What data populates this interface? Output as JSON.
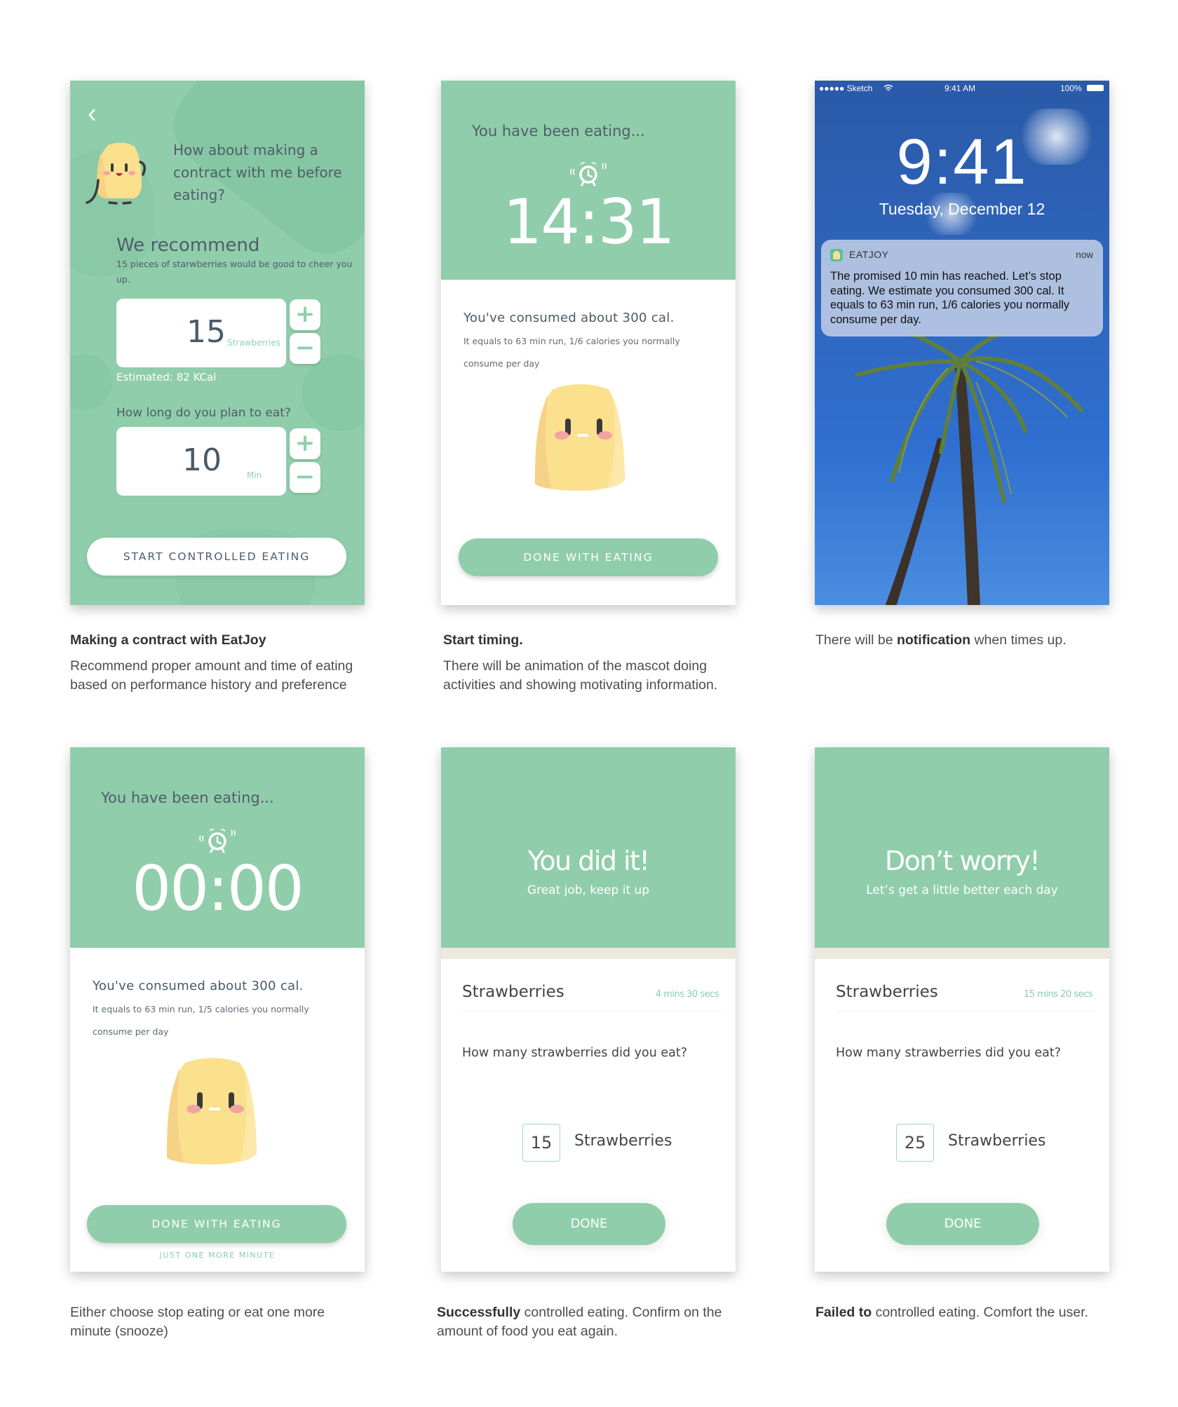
{
  "brand": {
    "accent": "#90cdab",
    "mascot_yellow": "#fbe08d",
    "text_dark": "#4f5d69"
  },
  "screens": {
    "contract": {
      "back_icon": "chevron-left-icon",
      "speech": "How about making a contract with me before eating?",
      "recommend_title": "We recommend",
      "recommend_sub": "15 pieces of starwberries would be good to cheer you up.",
      "amount_value": "15",
      "amount_unit": "Strawberries",
      "plus_label": "+",
      "minus_label": "−",
      "estimated": "Estimated: 82 KCal",
      "duration_question": "How long do you plan to eat?",
      "duration_value": "10",
      "duration_unit": "Min",
      "start_button": "START CONTROLLED EATING"
    },
    "timing": {
      "header": "You have been eating...",
      "timer": "14:31",
      "consumed": "You've consumed about 300 cal.",
      "equals": "It equals to 63 min run, 1/6 calories you normally consume per day",
      "done_button": "DONE WITH EATING"
    },
    "lockscreen": {
      "carrier": "●●●●● Sketch",
      "status_time": "9:41 AM",
      "battery": "100%",
      "time": "9:41",
      "date": "Tuesday, December 12",
      "notification": {
        "app": "EATJOY",
        "when": "now",
        "body": "The promised 10 min has reached. Let’s stop eating. We estimate you consumed 300 cal. It equals to 63 min run, 1/6 calories you normally consume per day."
      }
    },
    "timeup": {
      "header": "You have been eating...",
      "timer": "00:00",
      "consumed": "You've consumed about 300 cal.",
      "equals": "It equals to 63 min run, 1/5 calories you normally consume per day",
      "done_button": "DONE WITH EATING",
      "snooze_link": "JUST ONE MORE MINUTE"
    },
    "success": {
      "title": "You did it!",
      "subtitle": "Great job, keep it up",
      "food": "Strawberries",
      "duration": "4 mins 30 secs",
      "question": "How many strawberries did you eat?",
      "count": "15",
      "count_unit": "Strawberries",
      "done_button": "DONE"
    },
    "failure": {
      "title": "Don’t worry!",
      "subtitle": "Let’s get a little better each day",
      "food": "Strawberries",
      "duration": "15 mins 20 secs",
      "question": "How many strawberries did you eat?",
      "count": "25",
      "count_unit": "Strawberries",
      "done_button": "DONE"
    }
  },
  "captions": {
    "contract": {
      "title": "Making a contract with EatJoy",
      "body": "Recommend proper amount and time of eating based on performance history and preference"
    },
    "timing": {
      "title": "Start timing.",
      "body": "There will be animation of the mascot doing activities and showing motivating information."
    },
    "lockscreen": {
      "pre": "There will be ",
      "bold": "notification",
      "post": " when times up."
    },
    "timeup": {
      "body": "Either choose stop eating or eat one more minute (snooze)"
    },
    "success": {
      "bold": "Successfully",
      "post": " controlled eating. Confirm on the amount of food you eat again."
    },
    "failure": {
      "bold": "Failed to",
      "post": " controlled eating. Comfort the user."
    }
  }
}
